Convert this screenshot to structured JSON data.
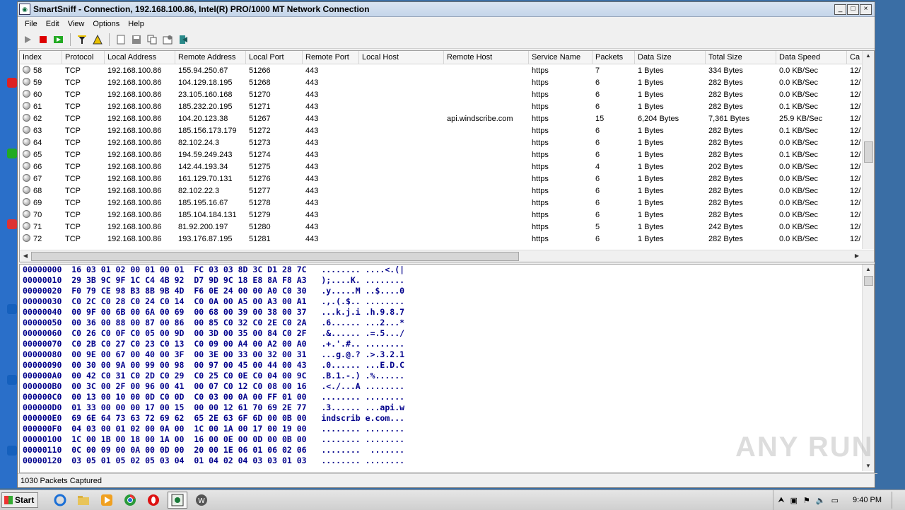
{
  "window": {
    "title": "SmartSniff  -  Connection, 192.168.100.86, Intel(R) PRO/1000 MT Network Connection",
    "minimize": "_",
    "maximize": "□",
    "close": "×"
  },
  "menu": [
    "File",
    "Edit",
    "View",
    "Options",
    "Help"
  ],
  "toolbar": [
    "start-capture-icon",
    "stop-capture-icon",
    "capture-options-icon",
    "filter-icon",
    "display-filter-icon",
    "new-icon",
    "save-icon",
    "copy-icon",
    "properties-icon",
    "exit-icon"
  ],
  "columns": [
    "Index",
    "Protocol",
    "Local Address",
    "Remote Address",
    "Local Port",
    "Remote Port",
    "Local Host",
    "Remote Host",
    "Service Name",
    "Packets",
    "Data Size",
    "Total Size",
    "Data Speed",
    "Ca"
  ],
  "rows": [
    [
      "58",
      "TCP",
      "192.168.100.86",
      "155.94.250.67",
      "51266",
      "443",
      "",
      "",
      "https",
      "7",
      "1 Bytes",
      "334 Bytes",
      "0.0 KB/Sec",
      "12/"
    ],
    [
      "59",
      "TCP",
      "192.168.100.86",
      "104.129.18.195",
      "51268",
      "443",
      "",
      "",
      "https",
      "6",
      "1 Bytes",
      "282 Bytes",
      "0.0 KB/Sec",
      "12/"
    ],
    [
      "60",
      "TCP",
      "192.168.100.86",
      "23.105.160.168",
      "51270",
      "443",
      "",
      "",
      "https",
      "6",
      "1 Bytes",
      "282 Bytes",
      "0.0 KB/Sec",
      "12/"
    ],
    [
      "61",
      "TCP",
      "192.168.100.86",
      "185.232.20.195",
      "51271",
      "443",
      "",
      "",
      "https",
      "6",
      "1 Bytes",
      "282 Bytes",
      "0.1 KB/Sec",
      "12/"
    ],
    [
      "62",
      "TCP",
      "192.168.100.86",
      "104.20.123.38",
      "51267",
      "443",
      "",
      "api.windscribe.com",
      "https",
      "15",
      "6,204 Bytes",
      "7,361 Bytes",
      "25.9 KB/Sec",
      "12/"
    ],
    [
      "63",
      "TCP",
      "192.168.100.86",
      "185.156.173.179",
      "51272",
      "443",
      "",
      "",
      "https",
      "6",
      "1 Bytes",
      "282 Bytes",
      "0.1 KB/Sec",
      "12/"
    ],
    [
      "64",
      "TCP",
      "192.168.100.86",
      "82.102.24.3",
      "51273",
      "443",
      "",
      "",
      "https",
      "6",
      "1 Bytes",
      "282 Bytes",
      "0.0 KB/Sec",
      "12/"
    ],
    [
      "65",
      "TCP",
      "192.168.100.86",
      "194.59.249.243",
      "51274",
      "443",
      "",
      "",
      "https",
      "6",
      "1 Bytes",
      "282 Bytes",
      "0.1 KB/Sec",
      "12/"
    ],
    [
      "66",
      "TCP",
      "192.168.100.86",
      "142.44.193.34",
      "51275",
      "443",
      "",
      "",
      "https",
      "4",
      "1 Bytes",
      "202 Bytes",
      "0.0 KB/Sec",
      "12/"
    ],
    [
      "67",
      "TCP",
      "192.168.100.86",
      "161.129.70.131",
      "51276",
      "443",
      "",
      "",
      "https",
      "6",
      "1 Bytes",
      "282 Bytes",
      "0.0 KB/Sec",
      "12/"
    ],
    [
      "68",
      "TCP",
      "192.168.100.86",
      "82.102.22.3",
      "51277",
      "443",
      "",
      "",
      "https",
      "6",
      "1 Bytes",
      "282 Bytes",
      "0.0 KB/Sec",
      "12/"
    ],
    [
      "69",
      "TCP",
      "192.168.100.86",
      "185.195.16.67",
      "51278",
      "443",
      "",
      "",
      "https",
      "6",
      "1 Bytes",
      "282 Bytes",
      "0.0 KB/Sec",
      "12/"
    ],
    [
      "70",
      "TCP",
      "192.168.100.86",
      "185.104.184.131",
      "51279",
      "443",
      "",
      "",
      "https",
      "6",
      "1 Bytes",
      "282 Bytes",
      "0.0 KB/Sec",
      "12/"
    ],
    [
      "71",
      "TCP",
      "192.168.100.86",
      "81.92.200.197",
      "51280",
      "443",
      "",
      "",
      "https",
      "5",
      "1 Bytes",
      "242 Bytes",
      "0.0 KB/Sec",
      "12/"
    ],
    [
      "72",
      "TCP",
      "192.168.100.86",
      "193.176.87.195",
      "51281",
      "443",
      "",
      "",
      "https",
      "6",
      "1 Bytes",
      "282 Bytes",
      "0.0 KB/Sec",
      "12/"
    ]
  ],
  "hex": [
    "00000000  16 03 01 02 00 01 00 01  FC 03 03 8D 3C D1 28 7C   ........ ....<.(|",
    "00000010  29 3B 9C 9F 1C C4 4B 92  D7 9D 9C 18 E8 8A F8 A3   );....K. ........",
    "00000020  F0 79 CE 98 B3 8B 9B 4D  F6 0E 24 00 00 A0 C0 30   .y.....M ..$....0",
    "00000030  C0 2C C0 28 C0 24 C0 14  C0 0A 00 A5 00 A3 00 A1   .,.(.$.. ........",
    "00000040  00 9F 00 6B 00 6A 00 69  00 68 00 39 00 38 00 37   ...k.j.i .h.9.8.7",
    "00000050  00 36 00 88 00 87 00 86  00 85 C0 32 C0 2E C0 2A   .6...... ...2...*",
    "00000060  C0 26 C0 0F C0 05 00 9D  00 3D 00 35 00 84 C0 2F   .&...... .=.5.../",
    "00000070  C0 2B C0 27 C0 23 C0 13  C0 09 00 A4 00 A2 00 A0   .+.'.#.. ........",
    "00000080  00 9E 00 67 00 40 00 3F  00 3E 00 33 00 32 00 31   ...g.@.? .>.3.2.1",
    "00000090  00 30 00 9A 00 99 00 98  00 97 00 45 00 44 00 43   .0...... ...E.D.C",
    "000000A0  00 42 C0 31 C0 2D C0 29  C0 25 C0 0E C0 04 00 9C   .B.1.-.) .%......",
    "000000B0  00 3C 00 2F 00 96 00 41  00 07 C0 12 C0 08 00 16   .<./...A ........",
    "000000C0  00 13 00 10 00 0D C0 0D  C0 03 00 0A 00 FF 01 00   ........ ........",
    "000000D0  01 33 00 00 00 17 00 15  00 00 12 61 70 69 2E 77   .3...... ...api.w",
    "000000E0  69 6E 64 73 63 72 69 62  65 2E 63 6F 6D 00 0B 00   indscrib e.com...",
    "000000F0  04 03 00 01 02 00 0A 00  1C 00 1A 00 17 00 19 00   ........ ........",
    "00000100  1C 00 1B 00 18 00 1A 00  16 00 0E 00 0D 00 0B 00   ........ ........",
    "00000110  0C 00 09 00 0A 00 0D 00  20 00 1E 06 01 06 02 06   ........  .......",
    "00000120  03 05 01 05 02 05 03 04  01 04 02 04 03 03 01 03   ........ ........"
  ],
  "status": "1030 Packets Captured",
  "taskbar": {
    "start": "Start",
    "apps": [
      "ie-icon",
      "explorer-icon",
      "media-player-icon",
      "chrome-icon",
      "opera-icon",
      "smartsniff-icon",
      "windscribe-icon"
    ],
    "clock": "9:40 PM"
  },
  "watermark": "ANY RUN"
}
